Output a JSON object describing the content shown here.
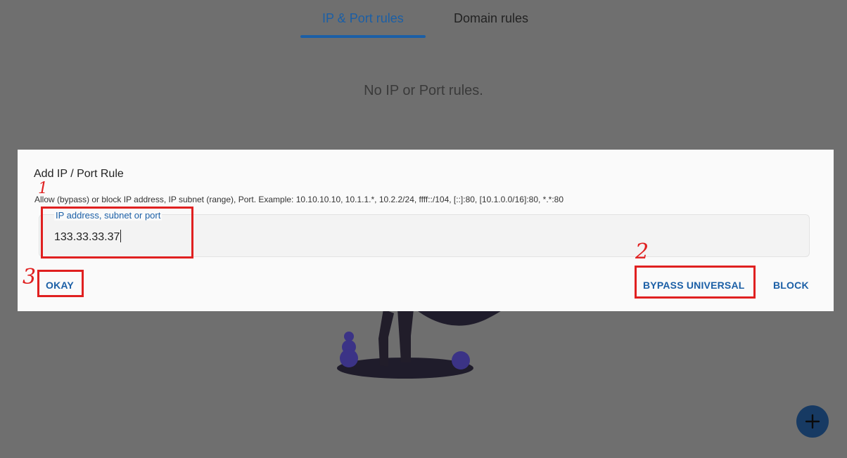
{
  "tabs": {
    "ip_port": "IP & Port rules",
    "domain": "Domain rules"
  },
  "empty_state": {
    "text": "No IP or Port rules."
  },
  "dialog": {
    "title": "Add IP / Port Rule",
    "description": "Allow (bypass) or block IP address, IP subnet (range), Port. Example: 10.10.10.10, 10.1.1.*, 10.2.2/24, ffff::/104, [::]:80, [10.1.0.0/16]:80, *.*:80",
    "field": {
      "label": "IP address, subnet or port",
      "value": "133.33.33.37"
    },
    "buttons": {
      "okay": "OKAY",
      "bypass_universal": "BYPASS UNIVERSAL",
      "block": "BLOCK"
    }
  },
  "annotations": {
    "n1": "1",
    "n2": "2",
    "n3": "3"
  },
  "fab": {
    "icon": "plus-icon"
  },
  "colors": {
    "accent": "#1b5fa6",
    "overlay": "#6f6f6f",
    "annotation": "#e02020",
    "fab": "#173a63"
  }
}
